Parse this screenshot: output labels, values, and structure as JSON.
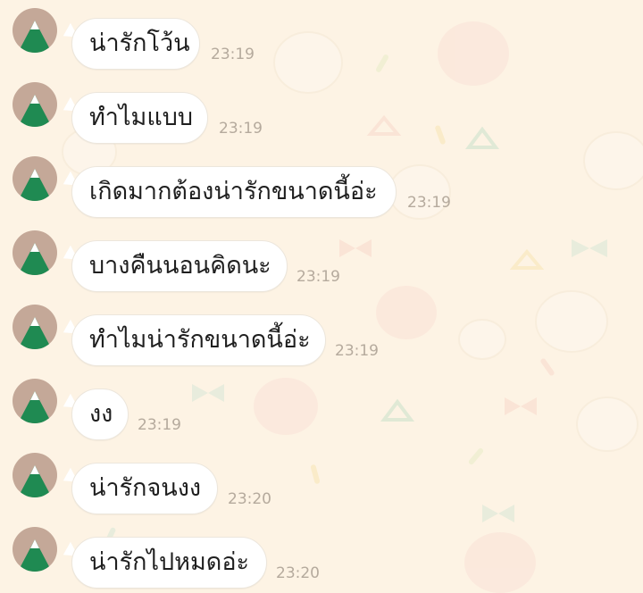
{
  "theme": {
    "background": "#fdf3e4",
    "bubble": "#ffffff",
    "text": "#1f1f1f",
    "timestamp": "#b5aa9d",
    "avatar_bg": "#c4a898",
    "avatar_mountain": "#1f8a52"
  },
  "messages": [
    {
      "text": "น่ารักโว้น",
      "time": "23:19"
    },
    {
      "text": "ทำไมแบบ",
      "time": "23:19"
    },
    {
      "text": "เกิดมากต้องน่ารักขนาดนี้อ่ะ",
      "time": "23:19"
    },
    {
      "text": "บางคืนนอนคิดนะ",
      "time": "23:19"
    },
    {
      "text": "ทำไมน่ารักขนาดนี้อ่ะ",
      "time": "23:19"
    },
    {
      "text": "งง",
      "time": "23:19"
    },
    {
      "text": "น่ารักจนงง",
      "time": "23:20"
    },
    {
      "text": "น่ารักไปหมดอ่ะ",
      "time": "23:20"
    }
  ]
}
